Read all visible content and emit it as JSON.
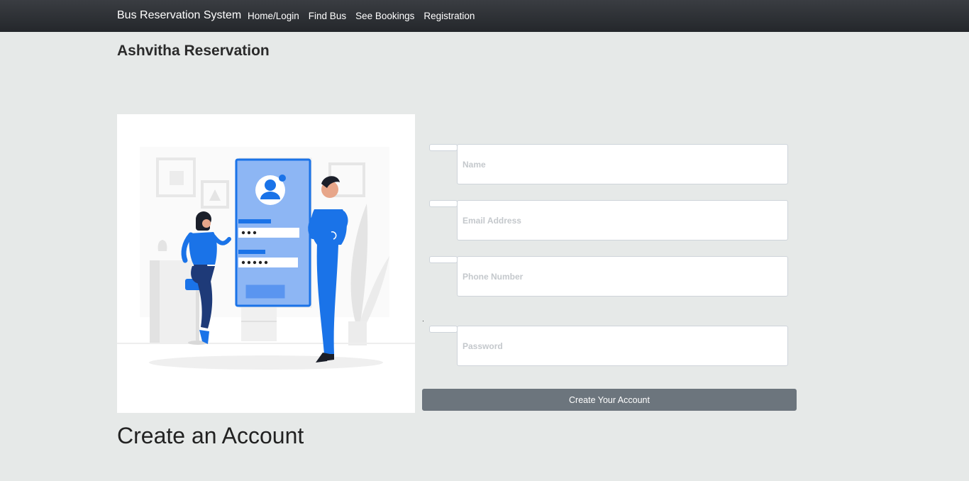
{
  "nav": {
    "brand": "Bus Reservation System",
    "links": [
      "Home/Login",
      "Find Bus",
      "See Bookings",
      "Registration"
    ]
  },
  "sub_title": "Ashvitha Reservation",
  "illustration": {
    "subject": "two people next to a large phone showing a sign-up form"
  },
  "form": {
    "fields": [
      {
        "placeholder": "Name",
        "value": ""
      },
      {
        "placeholder": "Email Address",
        "value": ""
      },
      {
        "placeholder": "Phone Number",
        "value": ""
      },
      {
        "placeholder": "Password",
        "value": ""
      }
    ],
    "submit_label": "Create Your Account"
  },
  "heading": "Create an Account",
  "colors": {
    "navbar": "#2f3236",
    "page_background": "#e6e9e8",
    "button": "#6c757d",
    "illustration_accent": "#1a73e8"
  }
}
